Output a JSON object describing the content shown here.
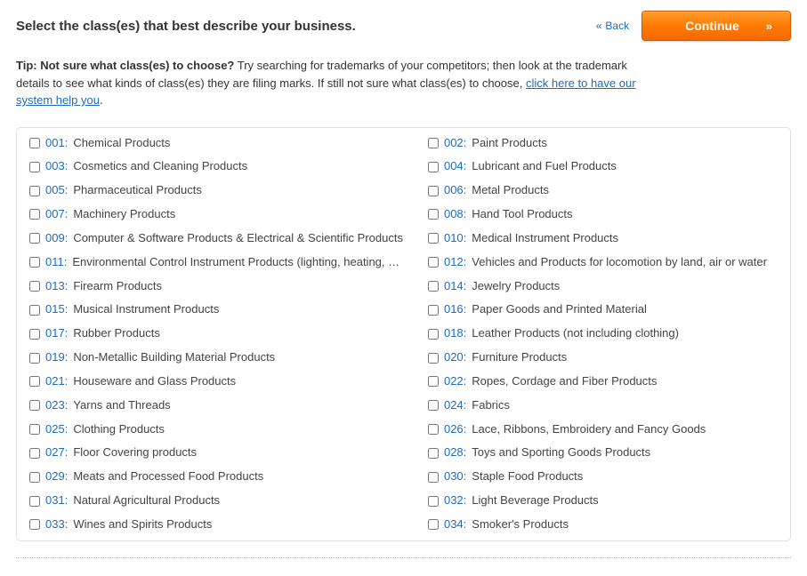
{
  "header": {
    "title": "Select the class(es) that best describe your business.",
    "back_label": "Back",
    "continue_label": "Continue"
  },
  "tip": {
    "bold": "Tip: Not sure what class(es) to choose?",
    "text_a": " Try searching for trademarks of your competitors; then look at the trademark details to see what kinds of class(es) they are filing marks. If still not sure what class(es) to choose, ",
    "link": "click here to have our system help you",
    "text_b": "."
  },
  "classes_left": [
    {
      "code": "001:",
      "name": "Chemical Products"
    },
    {
      "code": "003:",
      "name": "Cosmetics and Cleaning Products"
    },
    {
      "code": "005:",
      "name": "Pharmaceutical Products"
    },
    {
      "code": "007:",
      "name": "Machinery Products"
    },
    {
      "code": "009:",
      "name": "Computer & Software Products & Electrical & Scientific Products"
    },
    {
      "code": "011:",
      "name": "Environmental Control Instrument Products (lighting, heating, …"
    },
    {
      "code": "013:",
      "name": "Firearm Products"
    },
    {
      "code": "015:",
      "name": "Musical Instrument Products"
    },
    {
      "code": "017:",
      "name": "Rubber Products"
    },
    {
      "code": "019:",
      "name": "Non-Metallic Building Material Products"
    },
    {
      "code": "021:",
      "name": "Houseware and Glass Products"
    },
    {
      "code": "023:",
      "name": "Yarns and Threads"
    },
    {
      "code": "025:",
      "name": "Clothing Products"
    },
    {
      "code": "027:",
      "name": "Floor Covering products"
    },
    {
      "code": "029:",
      "name": "Meats and Processed Food Products"
    },
    {
      "code": "031:",
      "name": "Natural Agricultural Products"
    },
    {
      "code": "033:",
      "name": "Wines and Spirits Products"
    }
  ],
  "classes_right": [
    {
      "code": "002:",
      "name": "Paint Products"
    },
    {
      "code": "004:",
      "name": "Lubricant and Fuel Products"
    },
    {
      "code": "006:",
      "name": "Metal Products"
    },
    {
      "code": "008:",
      "name": "Hand Tool Products"
    },
    {
      "code": "010:",
      "name": "Medical Instrument Products"
    },
    {
      "code": "012:",
      "name": "Vehicles and Products for locomotion by land, air or water"
    },
    {
      "code": "014:",
      "name": "Jewelry Products"
    },
    {
      "code": "016:",
      "name": "Paper Goods and Printed Material"
    },
    {
      "code": "018:",
      "name": "Leather Products (not including clothing)"
    },
    {
      "code": "020:",
      "name": "Furniture Products"
    },
    {
      "code": "022:",
      "name": "Ropes, Cordage and Fiber Products"
    },
    {
      "code": "024:",
      "name": "Fabrics"
    },
    {
      "code": "026:",
      "name": "Lace, Ribbons, Embroidery and Fancy Goods"
    },
    {
      "code": "028:",
      "name": "Toys and Sporting Goods Products"
    },
    {
      "code": "030:",
      "name": "Staple Food Products"
    },
    {
      "code": "032:",
      "name": "Light Beverage Products"
    },
    {
      "code": "034:",
      "name": "Smoker's Products"
    }
  ]
}
